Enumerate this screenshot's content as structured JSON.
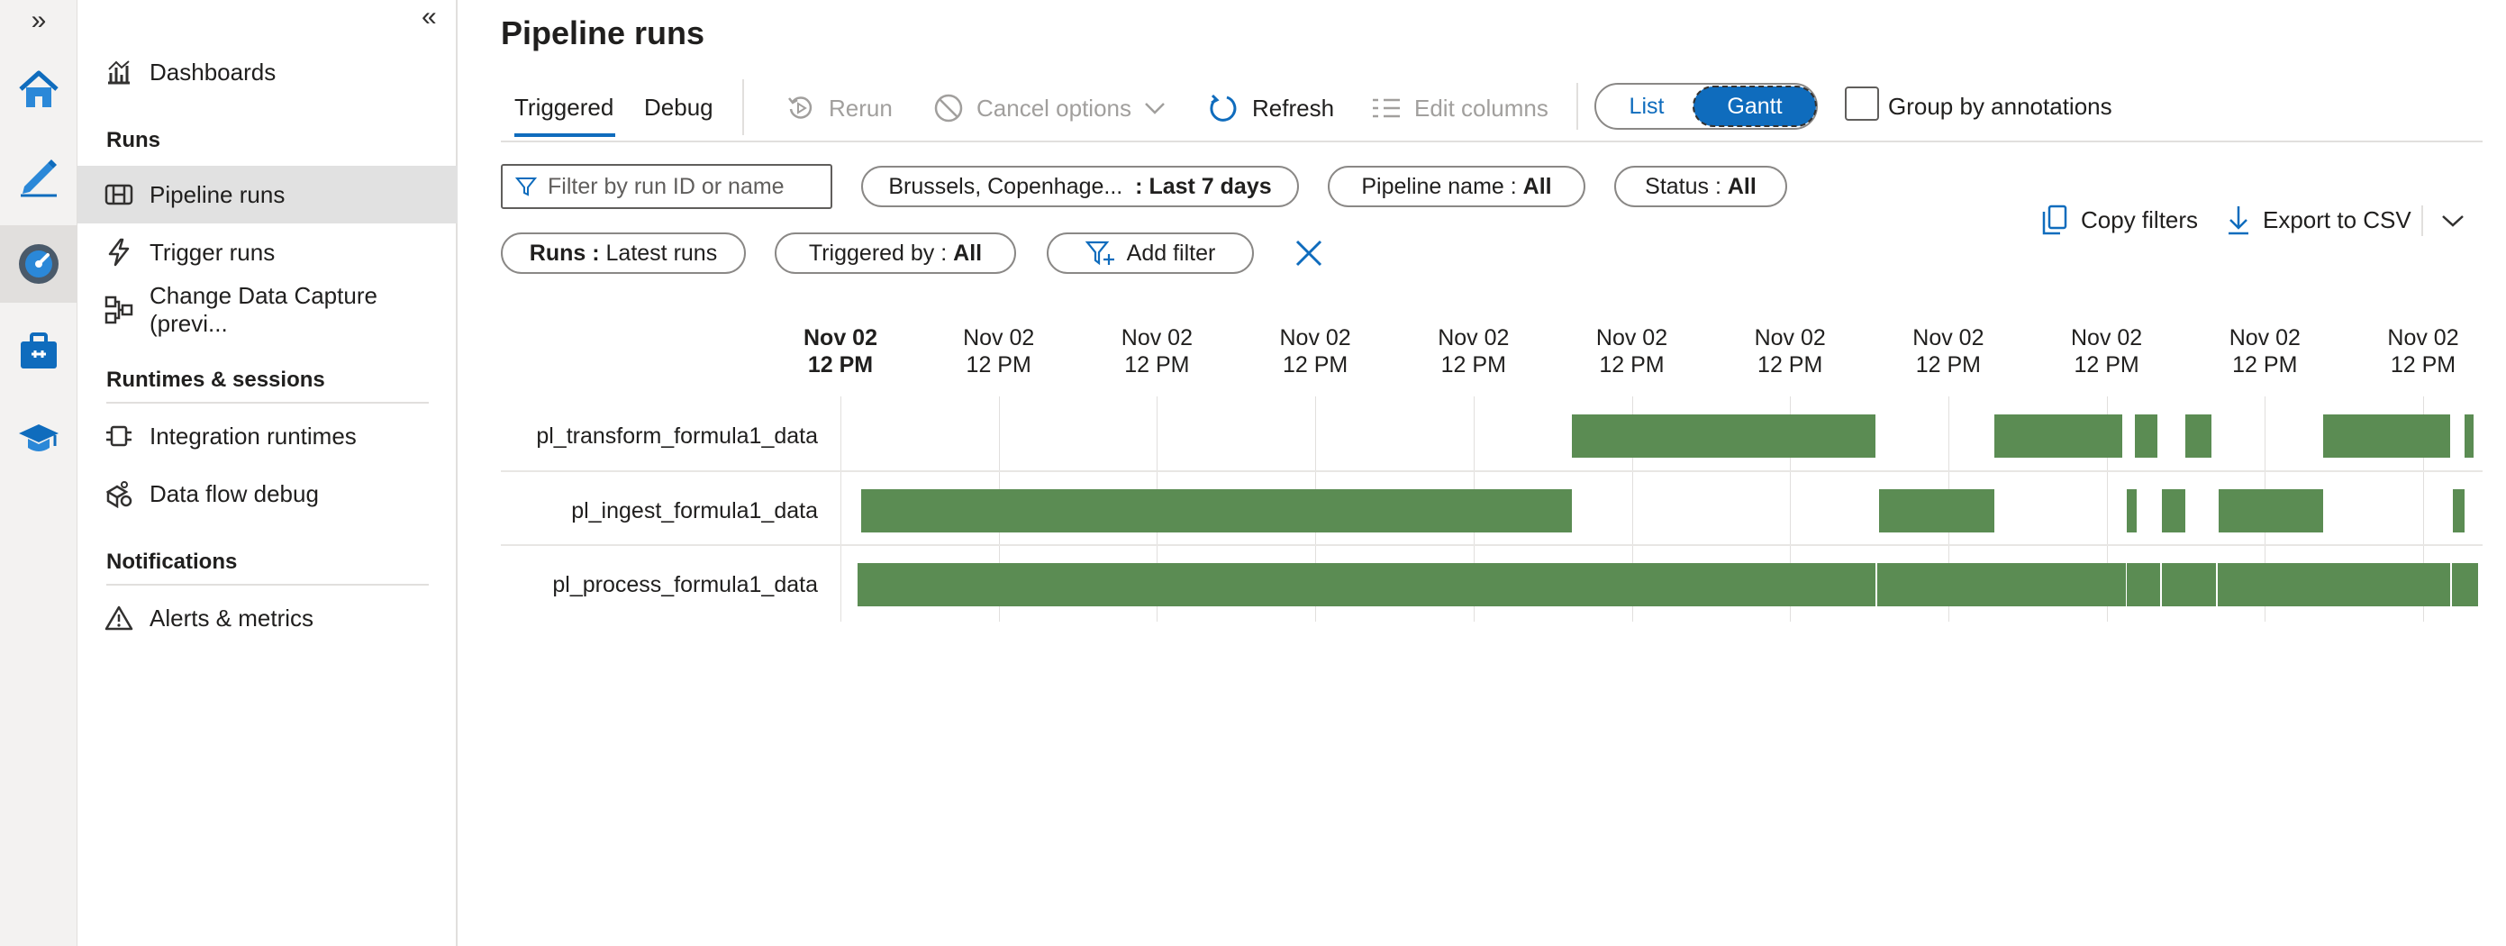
{
  "rail": {
    "expand_glyph": "»",
    "icons": [
      "home-icon",
      "author-pencil-icon",
      "monitor-icon",
      "manage-toolbox-icon",
      "learning-hat-icon"
    ]
  },
  "sidenav": {
    "collapse_glyph": "«",
    "dashboards": "Dashboards",
    "section_runs": "Runs",
    "pipeline_runs": "Pipeline runs",
    "trigger_runs": "Trigger runs",
    "change_data_capture": "Change Data Capture (previ...",
    "section_runtimes": "Runtimes & sessions",
    "integration_runtimes": "Integration runtimes",
    "data_flow_debug": "Data flow debug",
    "section_notifications": "Notifications",
    "alerts_metrics": "Alerts & metrics"
  },
  "page": {
    "title": "Pipeline runs",
    "tabs": {
      "triggered": "Triggered",
      "debug": "Debug"
    },
    "toolbar": {
      "rerun": "Rerun",
      "cancel_options": "Cancel options",
      "refresh": "Refresh",
      "edit_columns": "Edit columns",
      "view_list": "List",
      "view_gantt": "Gantt",
      "group_by_annotations": "Group by annotations"
    },
    "filters": {
      "search_placeholder": "Filter by run ID or name",
      "timezone_name": "Brussels, Copenhage...",
      "timezone_value": ": Last 7 days",
      "pipeline_name_label": "Pipeline name :",
      "pipeline_name_value": "All",
      "status_label": "Status :",
      "status_value": "All",
      "runs_label": "Runs :",
      "runs_value": "Latest runs",
      "triggered_by_label": "Triggered by :",
      "triggered_by_value": "All",
      "add_filter": "Add filter",
      "copy_filters": "Copy filters",
      "export_csv": "Export to CSV"
    }
  },
  "chart_data": {
    "type": "gantt",
    "bar_color": "#5b8c53",
    "x_ticks": [
      {
        "date": "Nov 02",
        "time": "12 PM",
        "bold": true
      },
      {
        "date": "Nov 02",
        "time": "12 PM"
      },
      {
        "date": "Nov 02",
        "time": "12 PM"
      },
      {
        "date": "Nov 02",
        "time": "12 PM"
      },
      {
        "date": "Nov 02",
        "time": "12 PM"
      },
      {
        "date": "Nov 02",
        "time": "12 PM"
      },
      {
        "date": "Nov 02",
        "time": "12 PM"
      },
      {
        "date": "Nov 02",
        "time": "12 PM"
      },
      {
        "date": "Nov 02",
        "time": "12 PM"
      },
      {
        "date": "Nov 02",
        "time": "12 PM"
      },
      {
        "date": "Nov 02",
        "time": "12 PM"
      }
    ],
    "rows": [
      {
        "name": "pl_transform_formula1_data",
        "runs": [
          [
            4.62,
            6.54
          ],
          [
            7.29,
            8.1
          ],
          [
            8.18,
            8.32
          ],
          [
            8.5,
            8.66
          ],
          [
            9.37,
            10.17
          ],
          [
            10.26,
            10.32
          ]
        ]
      },
      {
        "name": "pl_ingest_formula1_data",
        "runs": [
          [
            0.13,
            4.62
          ],
          [
            6.56,
            7.29
          ],
          [
            8.13,
            8.19
          ],
          [
            8.35,
            8.5
          ],
          [
            8.71,
            9.37
          ],
          [
            10.19,
            10.26
          ]
        ]
      },
      {
        "name": "pl_process_formula1_data",
        "runs": [
          [
            0.11,
            6.54
          ],
          [
            6.55,
            8.12
          ],
          [
            8.13,
            8.34
          ],
          [
            8.35,
            8.69
          ],
          [
            8.7,
            10.17
          ],
          [
            10.18,
            10.35
          ]
        ]
      }
    ]
  }
}
